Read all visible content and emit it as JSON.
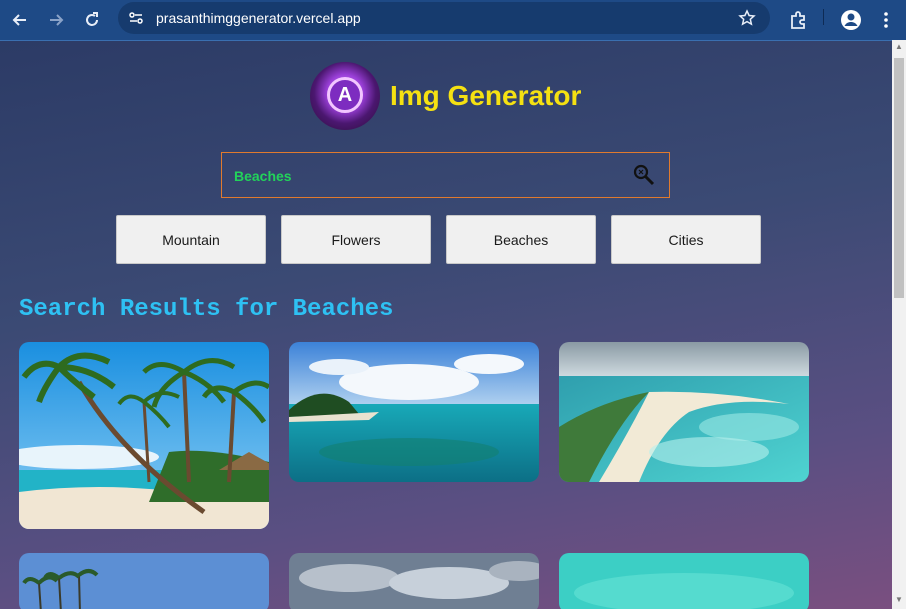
{
  "browser": {
    "url": "prasanthimggenerator.vercel.app"
  },
  "app": {
    "title": "Img Generator",
    "logo_letter": "A"
  },
  "search": {
    "value": "Beaches"
  },
  "categories": [
    "Mountain",
    "Flowers",
    "Beaches",
    "Cities"
  ],
  "results": {
    "heading": "Search Results for Beaches"
  },
  "colors": {
    "title_yellow": "#f5e112",
    "results_cyan": "#2ec1f3",
    "search_text_green": "#22d35a",
    "search_border": "#e07a2e"
  }
}
